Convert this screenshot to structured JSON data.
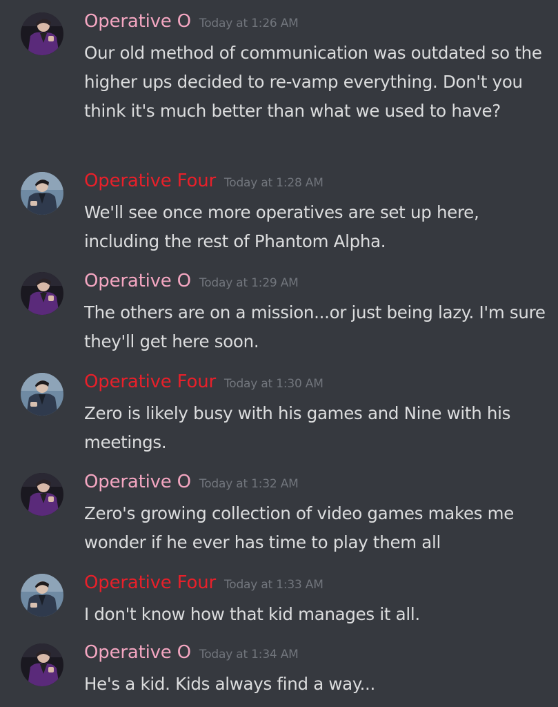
{
  "colors": {
    "background": "#36393f",
    "operative_o": "#f4a6c1",
    "operative_four": "#e8202a",
    "timestamp": "#72767d",
    "message_text": "#dcddde"
  },
  "messages": [
    {
      "author": "Operative O",
      "author_key": "operative_o",
      "avatar": "avatar-operative-o",
      "timestamp": "Today at 1:26 AM",
      "text": "Our old method of communication was outdated so the higher ups decided to re-vamp everything. Don't you think it's much better than what we used to have?"
    },
    {
      "author": "Operative Four",
      "author_key": "operative_four",
      "avatar": "avatar-operative-four",
      "timestamp": "Today at 1:28 AM",
      "text": "We'll see once more operatives are set up here, including the rest of Phantom Alpha."
    },
    {
      "author": "Operative O",
      "author_key": "operative_o",
      "avatar": "avatar-operative-o",
      "timestamp": "Today at 1:29 AM",
      "text": "The others are on a mission...or just being lazy. I'm sure they'll get here soon."
    },
    {
      "author": "Operative Four",
      "author_key": "operative_four",
      "avatar": "avatar-operative-four",
      "timestamp": "Today at 1:30 AM",
      "text": "Zero is likely busy with his games and Nine with his meetings."
    },
    {
      "author": "Operative O",
      "author_key": "operative_o",
      "avatar": "avatar-operative-o",
      "timestamp": "Today at 1:32 AM",
      "text": "Zero's growing collection of video games makes me wonder if he ever has time to play them all"
    },
    {
      "author": "Operative Four",
      "author_key": "operative_four",
      "avatar": "avatar-operative-four",
      "timestamp": "Today at 1:33 AM",
      "text": "I don't know how that kid manages it all."
    },
    {
      "author": "Operative O",
      "author_key": "operative_o",
      "avatar": "avatar-operative-o",
      "timestamp": "Today at 1:34 AM",
      "text": "He's a kid. Kids always find a way..."
    }
  ]
}
